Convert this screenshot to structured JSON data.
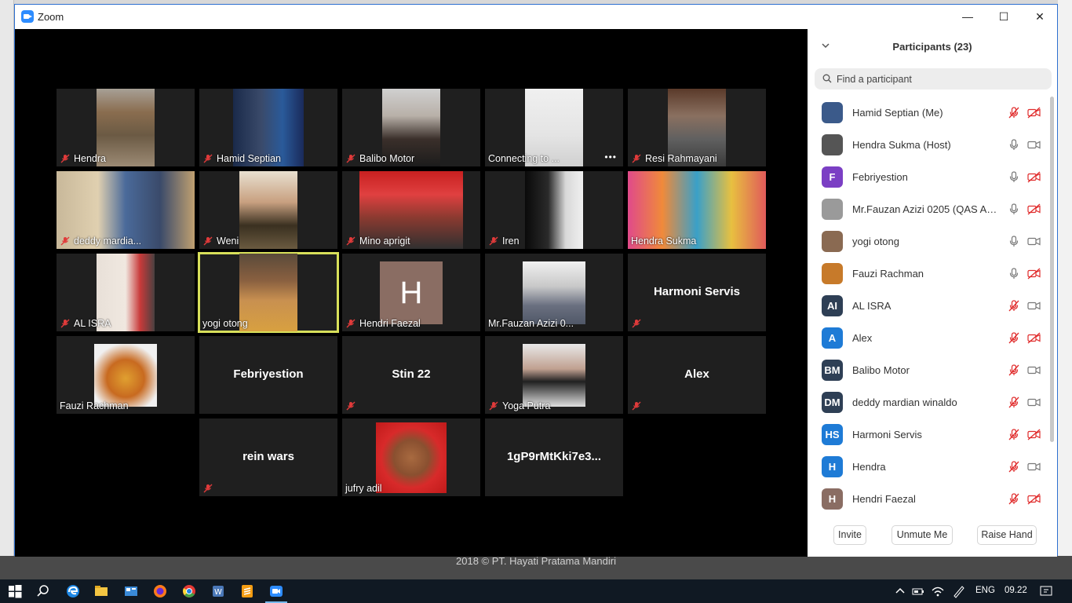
{
  "window": {
    "title": "Zoom",
    "minimize": "—",
    "maximize": "☐",
    "close": "✕"
  },
  "footer": {
    "text": "2018 © PT. Hayati Pratama Mandiri"
  },
  "tiles": [
    {
      "name": "Hendra",
      "muted": true,
      "video": true
    },
    {
      "name": "Hamid Septian",
      "muted": true,
      "video": true
    },
    {
      "name": "Balibo Motor",
      "muted": true,
      "video": true
    },
    {
      "name": "Connecting to ...",
      "muted": false,
      "video": true
    },
    {
      "name": "Resi Rahmayani",
      "muted": true,
      "video": true
    },
    {
      "name": "deddy mardia...",
      "muted": true,
      "video": true
    },
    {
      "name": "Weni",
      "muted": true,
      "video": true
    },
    {
      "name": "Mino aprigit",
      "muted": true,
      "video": true
    },
    {
      "name": "Iren",
      "muted": true,
      "video": true
    },
    {
      "name": "Hendra Sukma",
      "muted": false,
      "video": true
    },
    {
      "name": "AL ISRA",
      "muted": true,
      "video": true
    },
    {
      "name": "yogi otong",
      "muted": false,
      "video": true,
      "active": true
    },
    {
      "name": "Hendri Faezal",
      "muted": true,
      "avatar_letter": "H"
    },
    {
      "name": "Mr.Fauzan Azizi 0...",
      "muted": false,
      "video": true
    },
    {
      "name": "Harmoni Servis",
      "muted": true
    },
    {
      "name": "Fauzi Rachman",
      "muted": false,
      "video": true
    },
    {
      "name": "Febriyestion",
      "muted": false
    },
    {
      "name": "Stin 22",
      "muted": true
    },
    {
      "name": "Yoga Putra",
      "muted": true,
      "video": true
    },
    {
      "name": "Alex",
      "muted": true
    },
    {
      "name": "rein wars",
      "muted": true
    },
    {
      "name": "jufry adil",
      "muted": false,
      "video": true
    },
    {
      "name": "1gP9rMtKki7e3...",
      "muted": false
    }
  ],
  "panel": {
    "title": "Participants (23)",
    "search_placeholder": "Find a participant",
    "participants": [
      {
        "name": "Hamid Septian (Me)",
        "initials": "",
        "color": "#3b5a8a",
        "mic": "muted",
        "cam": "off"
      },
      {
        "name": "Hendra Sukma (Host)",
        "initials": "",
        "color": "#555555",
        "mic": "on",
        "cam": "on"
      },
      {
        "name": "Febriyestion",
        "initials": "F",
        "color": "#7b3fc4",
        "mic": "on",
        "cam": "off"
      },
      {
        "name": "Mr.Fauzan Azizi 0205 (QAS AN-...",
        "initials": "",
        "color": "#9a9a9a",
        "mic": "on",
        "cam": "off"
      },
      {
        "name": "yogi otong",
        "initials": "",
        "color": "#8a6a52",
        "mic": "on",
        "cam": "on"
      },
      {
        "name": "Fauzi Rachman",
        "initials": "",
        "color": "#c77a2a",
        "mic": "on",
        "cam": "off"
      },
      {
        "name": "AL ISRA",
        "initials": "AI",
        "color": "#2e3f55",
        "mic": "muted",
        "cam": "on"
      },
      {
        "name": "Alex",
        "initials": "A",
        "color": "#1e7bd6",
        "mic": "muted",
        "cam": "off"
      },
      {
        "name": "Balibo Motor",
        "initials": "BM",
        "color": "#2e3f55",
        "mic": "muted",
        "cam": "on"
      },
      {
        "name": "deddy mardian winaldo",
        "initials": "DM",
        "color": "#2e3f55",
        "mic": "muted",
        "cam": "on"
      },
      {
        "name": "Harmoni Servis",
        "initials": "HS",
        "color": "#1e7bd6",
        "mic": "muted",
        "cam": "off"
      },
      {
        "name": "Hendra",
        "initials": "H",
        "color": "#1e7bd6",
        "mic": "muted",
        "cam": "on"
      },
      {
        "name": "Hendri Faezal",
        "initials": "H",
        "color": "#8a6d63",
        "mic": "muted",
        "cam": "off"
      }
    ],
    "buttons": {
      "invite": "Invite",
      "unmute": "Unmute Me",
      "raise_hand": "Raise Hand"
    }
  },
  "taskbar": {
    "language": "ENG",
    "time": "09.22"
  }
}
